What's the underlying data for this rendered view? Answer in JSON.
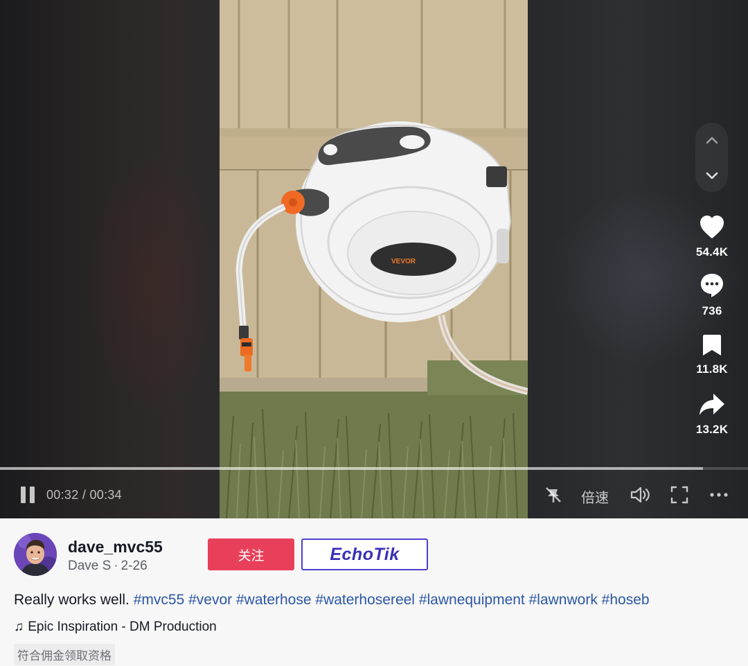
{
  "player": {
    "current_time": "00:32",
    "total_time": "00:34",
    "time_separator": " / ",
    "progress_fraction": 0.94,
    "speed_label": "倍速",
    "is_playing": true
  },
  "actions": {
    "likes": "54.4K",
    "comments": "736",
    "saves": "11.8K",
    "shares": "13.2K"
  },
  "video_overlay": {
    "brand_text": "VEVOR"
  },
  "author": {
    "username": "dave_mvc55",
    "display_name": "Dave S",
    "date": "2-26",
    "separator": "·"
  },
  "buttons": {
    "follow_label": "关注",
    "echotik_label": "EchoTik"
  },
  "caption": {
    "text": "Really works well.",
    "hashtags": [
      "#mvc55",
      "#vevor",
      "#waterhose",
      "#waterhosereel",
      "#lawnequipment",
      "#lawnwork",
      "#hoseb"
    ]
  },
  "music": {
    "title": "Epic Inspiration - DM Production"
  },
  "eligibility_badge": "符合佣金领取资格",
  "colors": {
    "follow_red": "#e8405a",
    "hashtag_blue": "#2b56a5",
    "echotik_purple": "#3a2fb8"
  }
}
